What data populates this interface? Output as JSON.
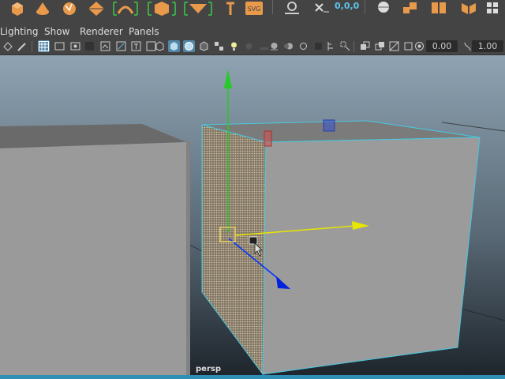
{
  "shelf": {
    "icons": [
      "cube-icon",
      "cone-icon",
      "sphere-arrow-icon",
      "diamond-icon",
      "bracket-arc-icon",
      "bracket-box-icon",
      "bracket-sweep-icon",
      "text-tool-icon",
      "svg-icon",
      "select-ring-icon",
      "delete-xyz-icon",
      "sphere-icon",
      "merge-icon",
      "split-icon",
      "grid-icon"
    ],
    "coord_label": "0,0,0",
    "svg_label": "SVG"
  },
  "menubar": {
    "items": [
      "Lighting",
      "Show",
      "Renderer",
      "Panels"
    ]
  },
  "toolbar": {
    "field1": "0.00",
    "field2": "1.00"
  },
  "viewport": {
    "camera_label": "persp"
  },
  "colors": {
    "selection": "#48c8e0",
    "y_axis": "#22cc22",
    "x_axis": "#e6e600",
    "z_axis": "#0033ff"
  }
}
